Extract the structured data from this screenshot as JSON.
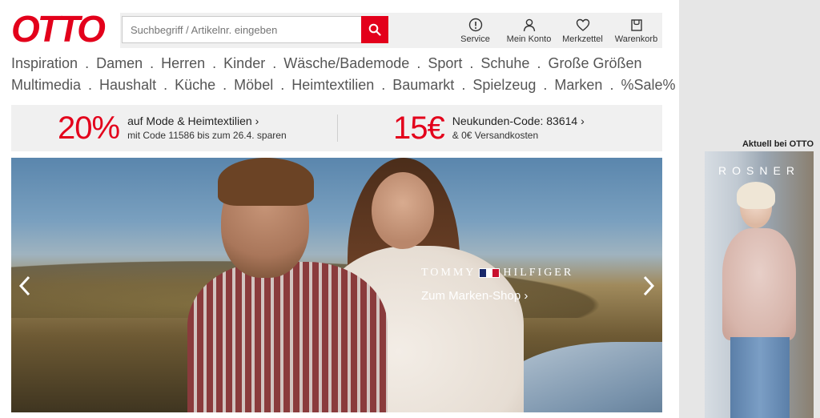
{
  "brand": {
    "logo_text": "OTTO",
    "accent_color": "#e3001b"
  },
  "search": {
    "placeholder": "Suchbegriff / Artikelnr. eingeben",
    "icon": "search-icon"
  },
  "header_links": [
    {
      "label": "Service",
      "icon": "info-icon"
    },
    {
      "label": "Mein Konto",
      "icon": "user-icon"
    },
    {
      "label": "Merkzettel",
      "icon": "heart-icon"
    },
    {
      "label": "Warenkorb",
      "icon": "cart-icon"
    }
  ],
  "categories": {
    "row1": [
      "Inspiration",
      "Damen",
      "Herren",
      "Kinder",
      "Wäsche/Bademode",
      "Sport",
      "Schuhe",
      "Große Größen"
    ],
    "row2": [
      "Multimedia",
      "Haushalt",
      "Küche",
      "Möbel",
      "Heimtextilien",
      "Baumarkt",
      "Spielzeug",
      "Marken",
      "%Sale%"
    ],
    "separator": "."
  },
  "promos": [
    {
      "big": "20%",
      "title": "auf Mode & Heimtextilien ›",
      "subtitle": "mit Code 11586 bis zum 26.4. sparen"
    },
    {
      "big": "15€",
      "title": "Neukunden-Code: 83614 ›",
      "subtitle": "& 0€ Versandkosten"
    }
  ],
  "hero": {
    "brand_left": "TOMMY",
    "brand_right": "HILFIGER",
    "cta": "Zum Marken-Shop ›"
  },
  "sidebar": {
    "title": "Aktuell bei OTTO",
    "ad_brand": "ROSNER"
  }
}
